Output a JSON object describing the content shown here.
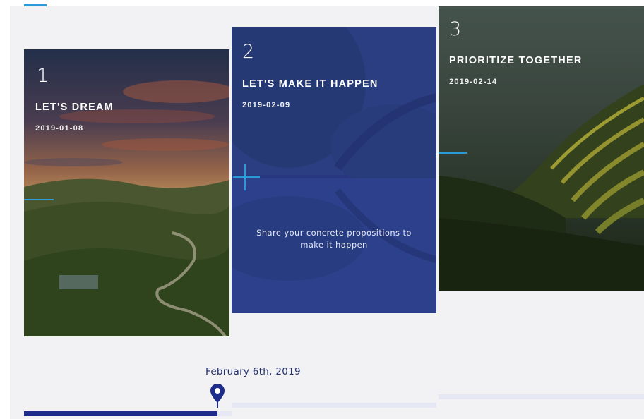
{
  "colors": {
    "accent": "#2a9bd8",
    "progress_fill": "#1d2b8c",
    "progress_track": "#e6e7f5",
    "label_text": "#23306a",
    "card2_overlay": "#2b3890"
  },
  "cards": [
    {
      "number": "1",
      "title": "LET'S DREAM",
      "date": "2019-01-08",
      "image": "tuscan-hills-sunset"
    },
    {
      "number": "2",
      "title": "LET'S MAKE IT HAPPEN",
      "date": "2019-02-09",
      "description_line1": "Share your concrete propositions to",
      "description_line2": "make it happen",
      "image": "bridge-reflection-lake"
    },
    {
      "number": "3",
      "title": "PRIORITIZE TOGETHER",
      "date": "2019-02-14",
      "image": "rice-terraces"
    }
  ],
  "timeline": {
    "current_date_label": "February 6th, 2019",
    "progress_percent": 31,
    "marker_icon": "map-pin-icon"
  }
}
